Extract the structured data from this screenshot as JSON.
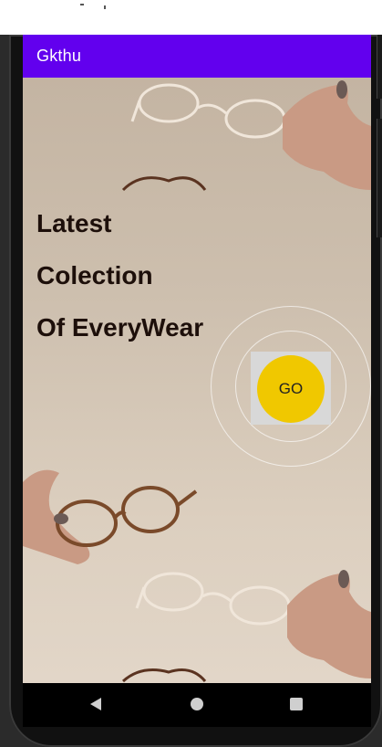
{
  "app": {
    "title": "Gkthu"
  },
  "main": {
    "headline_lines": [
      "Latest",
      "Colection",
      "Of EveryWear"
    ],
    "go_label": "GO"
  },
  "colors": {
    "app_bar": "#6200ee",
    "go_button": "#f0c800",
    "headline_text": "#1d0f0a",
    "nav_bar": "#000000"
  },
  "icons": {
    "nav_back": "triangle-back-icon",
    "nav_home": "circle-home-icon",
    "nav_recents": "square-recents-icon"
  }
}
